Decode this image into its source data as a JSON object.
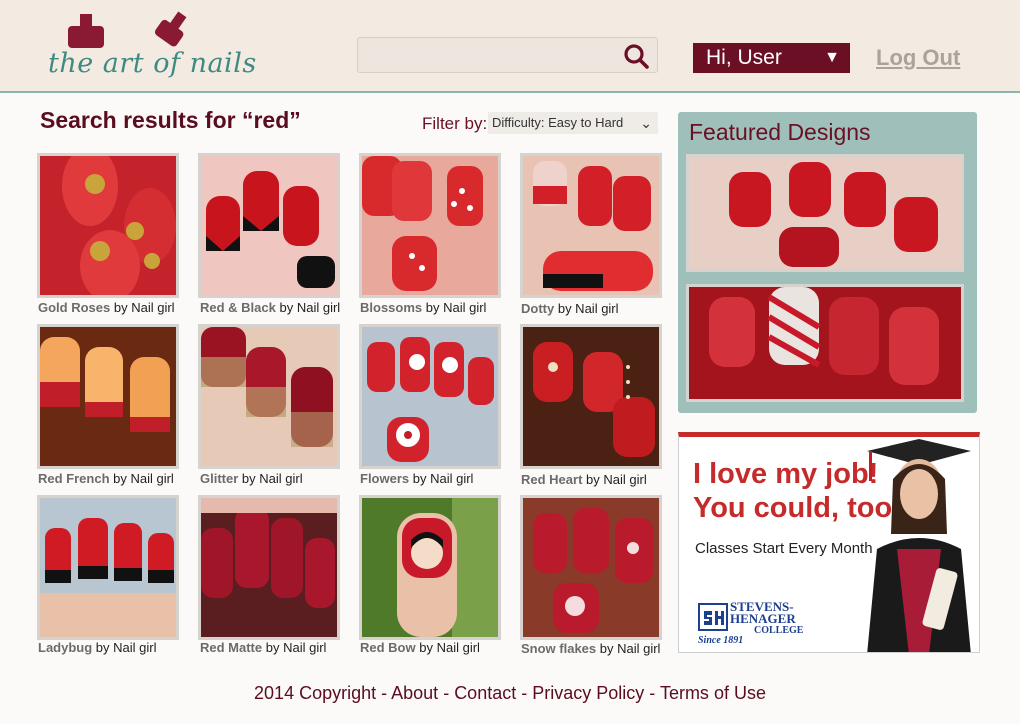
{
  "header": {
    "logo_text": "the art of nails",
    "search": {
      "value": "",
      "placeholder": ""
    },
    "user_menu_label": "Hi, User",
    "logout_label": "Log Out"
  },
  "main": {
    "title": "Search results for “red”",
    "filter": {
      "label": "Filter by:",
      "selected": "Difficulty: Easy to Hard"
    },
    "results": [
      {
        "name": "Gold Roses",
        "author": "by Nail girl"
      },
      {
        "name": "Red & Black",
        "author": "by Nail girl"
      },
      {
        "name": "Blossoms",
        "author": "by Nail girl"
      },
      {
        "name": "Dotty",
        "author": "by Nail girl"
      },
      {
        "name": "Red French",
        "author": "by Nail girl"
      },
      {
        "name": "Glitter",
        "author": "by Nail girl"
      },
      {
        "name": "Flowers",
        "author": "by Nail girl"
      },
      {
        "name": "Red Heart",
        "author": "by Nail girl"
      },
      {
        "name": "Ladybug",
        "author": "by Nail girl"
      },
      {
        "name": "Red Matte",
        "author": "by Nail girl"
      },
      {
        "name": "Red Bow",
        "author": "by Nail girl"
      },
      {
        "name": "Snow flakes",
        "author": "by Nail girl"
      }
    ]
  },
  "featured": {
    "title": "Featured Designs"
  },
  "ad": {
    "headline_1": "I love my job!",
    "headline_2": "You could, too.",
    "subtext": "Classes Start Every Month",
    "college_line_1": "STEVENS-",
    "college_line_2": "HENAGER",
    "college_line_3": "COLLEGE",
    "since": "Since 1891"
  },
  "footer": {
    "copyright": "2014 Copyright",
    "links": [
      "About",
      "Contact",
      "Privacy Policy",
      "Terms of Use"
    ],
    "separator": " - "
  },
  "colors": {
    "brand": "#6b0f24",
    "accent": "#3f8a82",
    "featured_bg": "#9fbfba",
    "header_bg": "#f3ebe2"
  }
}
